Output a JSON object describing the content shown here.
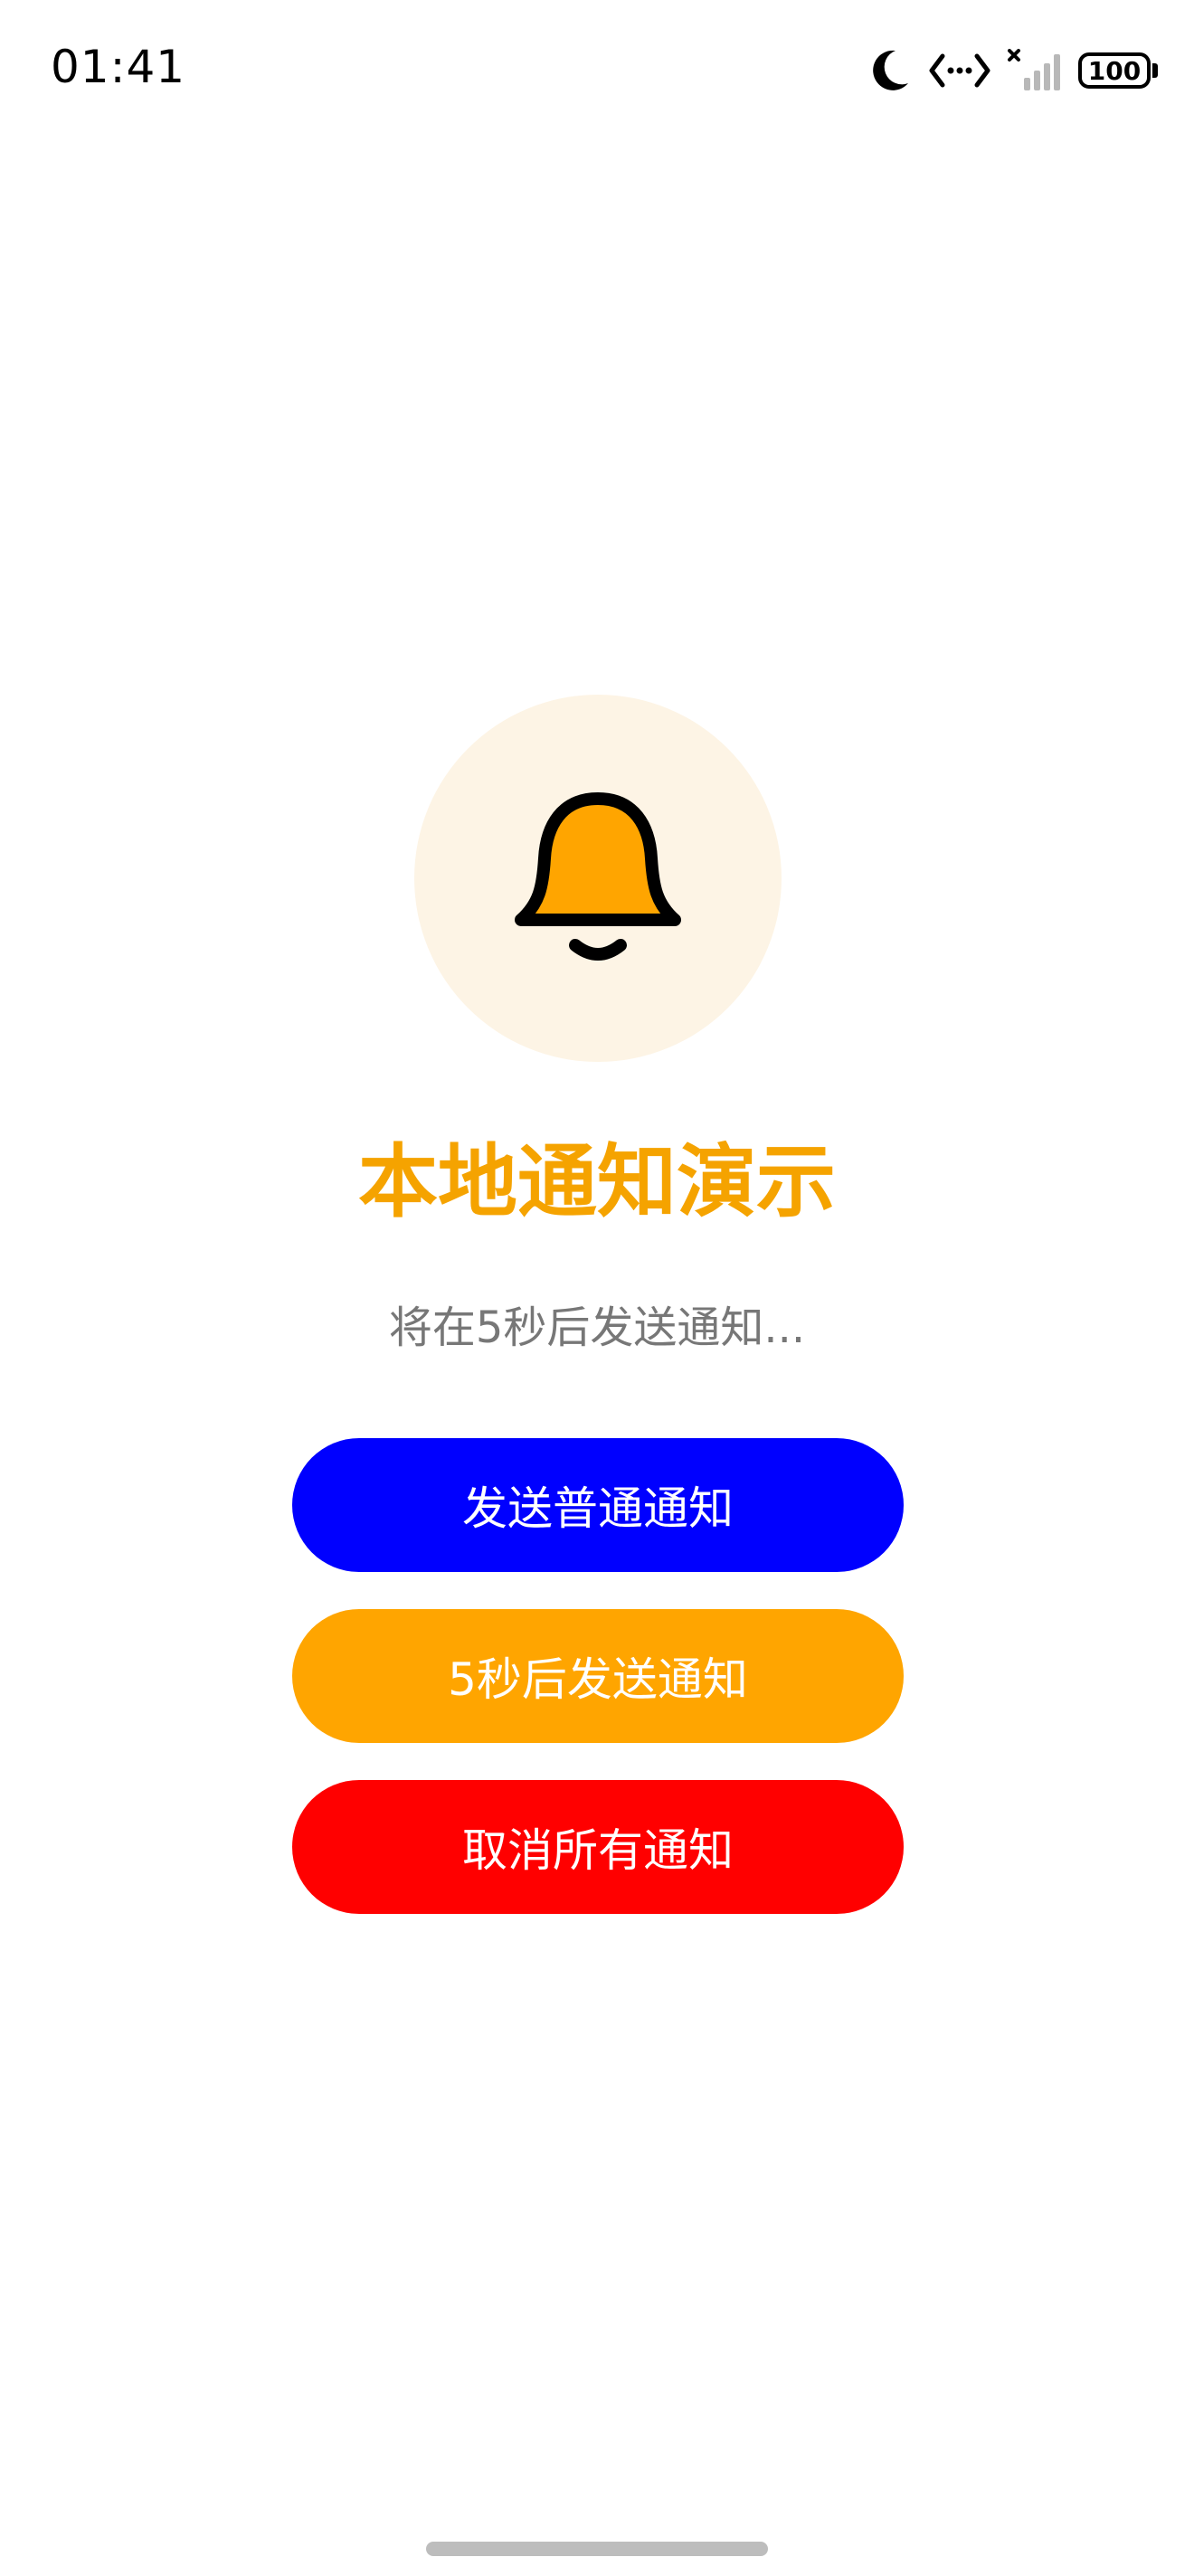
{
  "status_bar": {
    "time": "01:41",
    "battery": "100",
    "icons": [
      "moon-icon",
      "data-transfer-icon",
      "signal-no-sim-icon",
      "battery-icon"
    ]
  },
  "hero": {
    "icon": "bell-icon",
    "icon_color": "#ffa500",
    "circle_color": "#fdf4e5"
  },
  "title": "本地通知演示",
  "title_color": "#f5a300",
  "subtitle": "将在5秒后发送通知...",
  "buttons": {
    "send_now": {
      "label": "发送普通通知",
      "color": "#0000ff"
    },
    "send_delayed": {
      "label": "5秒后发送通知",
      "color": "#ffa500"
    },
    "cancel_all": {
      "label": "取消所有通知",
      "color": "#ff0000"
    }
  }
}
